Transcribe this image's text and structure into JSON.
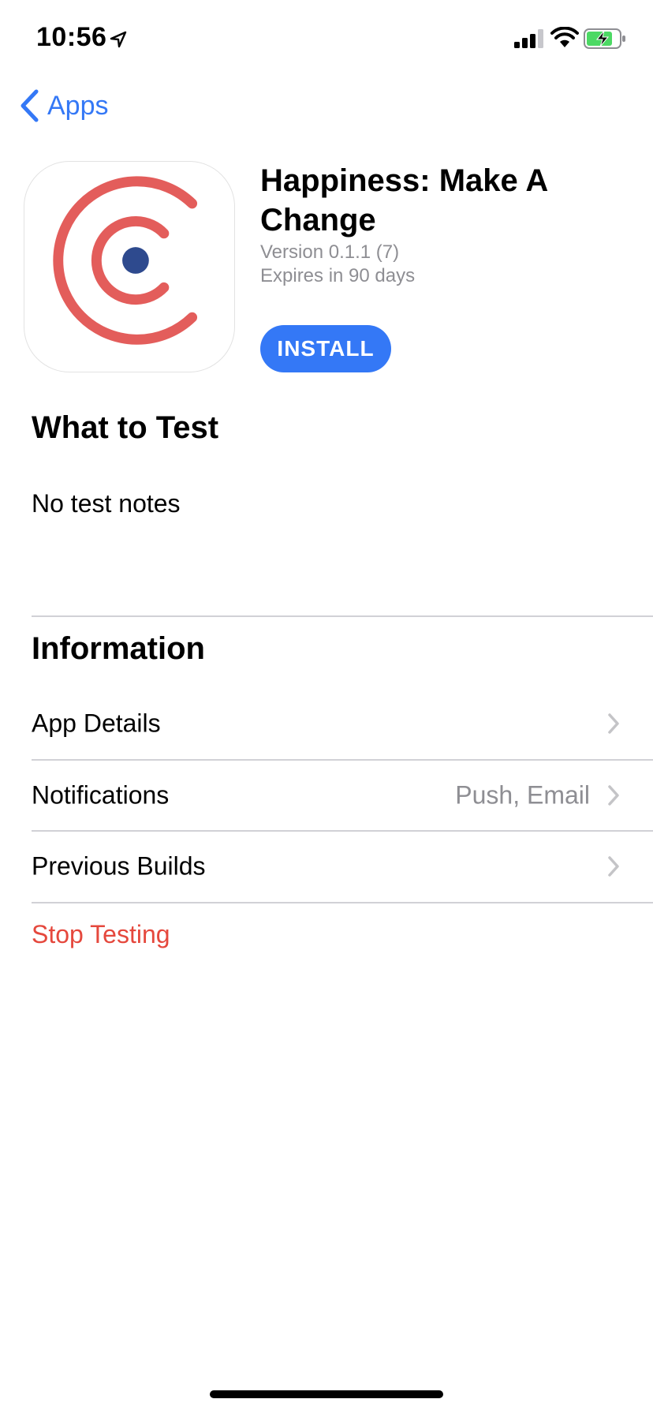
{
  "status_bar": {
    "time": "10:56",
    "icons": [
      "location-arrow-icon",
      "cellular-signal-icon",
      "wifi-icon",
      "battery-charging-icon"
    ]
  },
  "nav": {
    "back_label": "Apps"
  },
  "app": {
    "title": "Happiness: Make A Change",
    "version": "Version 0.1.1 (7)",
    "expires": "Expires in 90 days",
    "install_label": "INSTALL",
    "icon": "happiness-app-icon"
  },
  "what_to_test": {
    "title": "What to Test",
    "notes": "No test notes"
  },
  "information": {
    "title": "Information",
    "rows": [
      {
        "label": "App Details",
        "value": ""
      },
      {
        "label": "Notifications",
        "value": "Push, Email"
      },
      {
        "label": "Previous Builds",
        "value": ""
      }
    ],
    "stop_label": "Stop Testing"
  },
  "colors": {
    "accent": "#3478f6",
    "destructive": "#e5483d",
    "secondary_text": "#8e8e93",
    "app_icon_red": "#e35d5b",
    "app_icon_navy": "#2e4a8e",
    "battery_green": "#4cd964"
  }
}
